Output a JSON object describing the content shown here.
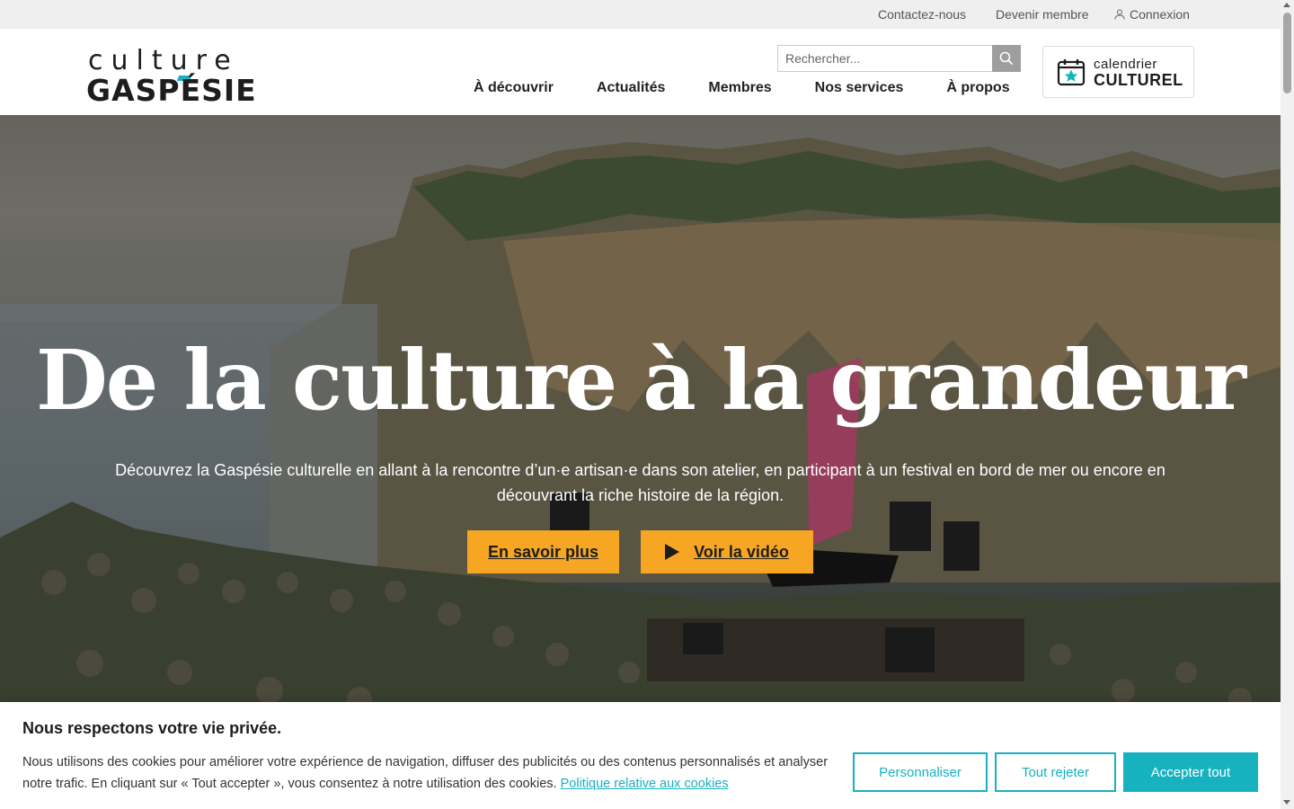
{
  "topbar": {
    "contact": "Contactez-nous",
    "member": "Devenir membre",
    "login": "Connexion"
  },
  "logo": {
    "line1": "culture",
    "line2": "GASPÉSIE"
  },
  "search": {
    "placeholder": "Rechercher..."
  },
  "nav": {
    "items": [
      "À découvrir",
      "Actualités",
      "Membres",
      "Nos services",
      "À propos"
    ]
  },
  "calendar": {
    "line1": "calendrier",
    "line2": "CULTUREL"
  },
  "hero": {
    "title": "De la culture à la grandeur",
    "lead": "Découvrez la Gaspésie culturelle en allant à la rencontre d’un·e artisan·e dans son atelier, en participant à un festival en bord de mer ou encore en découvrant la riche histoire de la région.",
    "btn_more": "En savoir plus",
    "btn_video": "Voir la vidéo"
  },
  "cookie": {
    "title": "Nous respectons votre vie privée.",
    "text": "Nous utilisons des cookies pour améliorer votre expérience de navigation, diffuser des publicités ou des contenus personnalisés et analyser notre trafic. En cliquant sur « Tout accepter », vous consentez à notre utilisation des cookies.",
    "link": "Politique relative aux cookies",
    "personalize": "Personnaliser",
    "reject": "Tout rejeter",
    "accept": "Accepter tout"
  },
  "colors": {
    "accent": "#17b2c0",
    "button_yellow": "#f6a623",
    "topbar_bg": "#efefef",
    "text_dark": "#1d1d1d"
  },
  "icons": {
    "search": "search-icon",
    "user": "user-icon",
    "calendar": "calendar-star-icon",
    "play": "play-icon"
  }
}
